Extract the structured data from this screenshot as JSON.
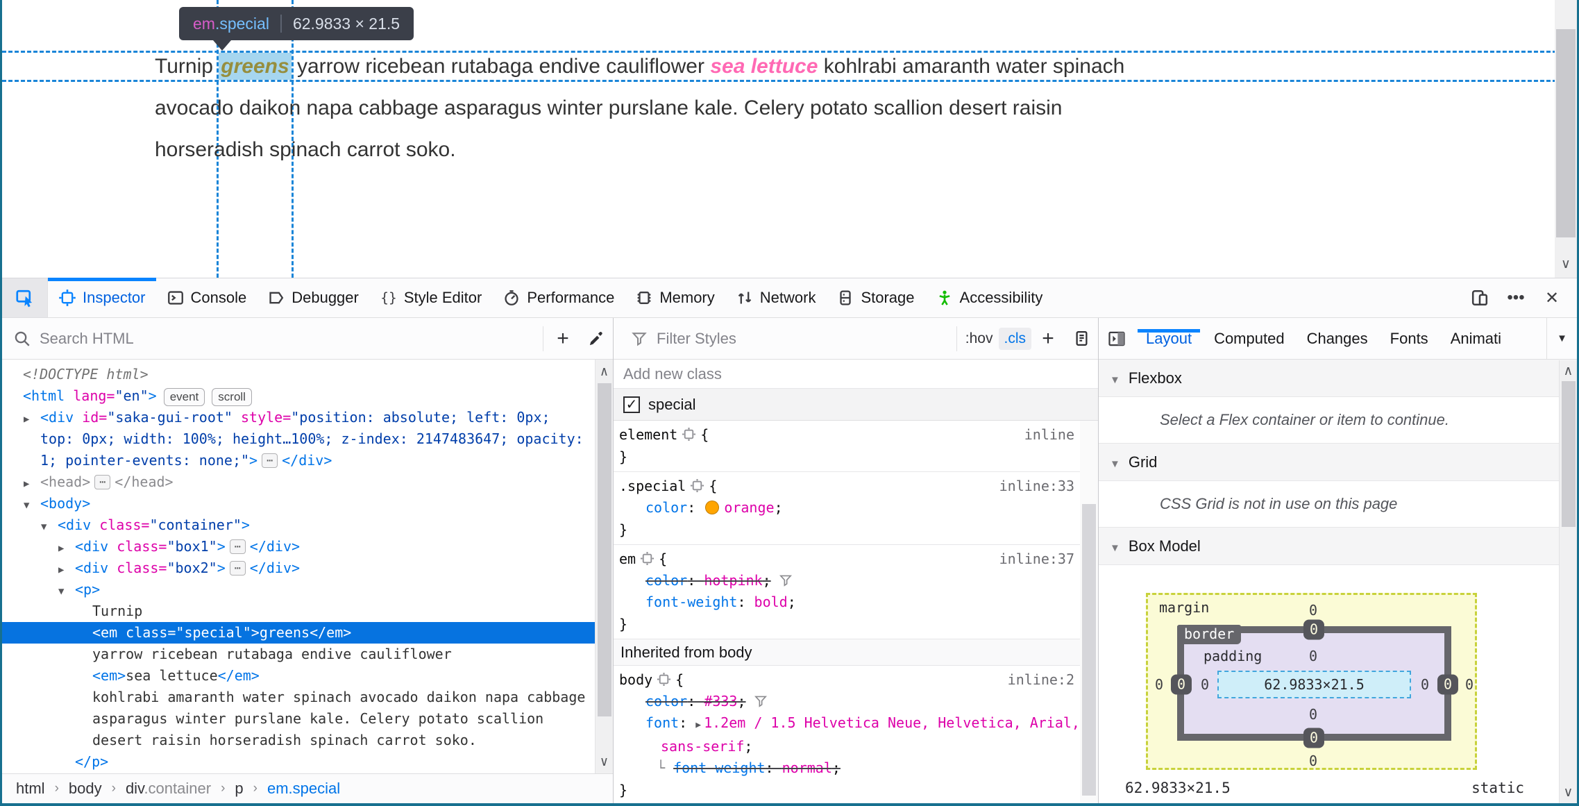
{
  "window": {
    "border_color": "#17708f",
    "accent_blue": "#0a84ff"
  },
  "page": {
    "tooltip": {
      "tag": "em",
      "class": ".special",
      "dims": "62.9833 × 21.5"
    },
    "lines": [
      [
        {
          "c": "plain",
          "t": "Turnip "
        },
        {
          "c": "special",
          "t": "greens"
        },
        {
          "c": "plain",
          "t": " yarrow ricebean rutabaga endive cauliflower "
        },
        {
          "c": "em",
          "t": "sea lettuce"
        },
        {
          "c": "plain",
          "t": " kohlrabi amaranth water spinach"
        }
      ],
      [
        {
          "c": "plain",
          "t": "avocado daikon napa cabbage asparagus winter purslane kale. Celery potato scallion desert raisin"
        }
      ],
      [
        {
          "c": "plain",
          "t": "horseradish spinach carrot soko."
        }
      ]
    ]
  },
  "toolbar": {
    "tabs": [
      {
        "icon": "inspector-icon",
        "label": "Inspector",
        "active": true
      },
      {
        "icon": "console-icon",
        "label": "Console"
      },
      {
        "icon": "debugger-icon",
        "label": "Debugger"
      },
      {
        "icon": "style-editor-icon",
        "label": "Style Editor"
      },
      {
        "icon": "performance-icon",
        "label": "Performance"
      },
      {
        "icon": "memory-icon",
        "label": "Memory"
      },
      {
        "icon": "network-icon",
        "label": "Network"
      },
      {
        "icon": "storage-icon",
        "label": "Storage"
      },
      {
        "icon": "accessibility-icon",
        "label": "Accessibility",
        "icon_color": "#12bc00"
      }
    ],
    "overflow": "•••",
    "close": "✕"
  },
  "markup": {
    "search_placeholder": "Search HTML",
    "add_label": "+",
    "tree": [
      {
        "indent": 0,
        "segs": [
          {
            "c": "doc",
            "t": "<!DOCTYPE html>"
          }
        ]
      },
      {
        "indent": 0,
        "segs": [
          {
            "c": "tag",
            "t": "<html"
          },
          {
            "c": "attr",
            "t": " lang="
          },
          {
            "c": "val",
            "t": "\"en\""
          },
          {
            "c": "tag",
            "t": ">"
          },
          {
            "c": "badge",
            "t": "event"
          },
          {
            "c": "badge",
            "t": "scroll"
          }
        ]
      },
      {
        "indent": 1,
        "arrow": "r",
        "segs": [
          {
            "c": "tag",
            "t": "<div"
          },
          {
            "c": "attr",
            "t": " id="
          },
          {
            "c": "val",
            "t": "\"saka-gui-root\""
          },
          {
            "c": "attr",
            "t": " style="
          },
          {
            "c": "val",
            "t": "\"position: absolute; left: 0px;"
          }
        ]
      },
      {
        "indent": 1,
        "segs": [
          {
            "c": "val",
            "t": "top: 0px; width: 100%; height…100%; z-index: 2147483647; opacity:"
          }
        ]
      },
      {
        "indent": 1,
        "segs": [
          {
            "c": "val",
            "t": "1; pointer-events: none;\""
          },
          {
            "c": "tag",
            "t": ">"
          },
          {
            "c": "chip",
            "t": "⋯"
          },
          {
            "c": "tag",
            "t": "</div>"
          }
        ]
      },
      {
        "indent": 1,
        "arrow": "r",
        "segs": [
          {
            "c": "dim",
            "t": "<head>"
          },
          {
            "c": "chip",
            "t": "⋯"
          },
          {
            "c": "dim",
            "t": "</head>"
          }
        ]
      },
      {
        "indent": 1,
        "arrow": "d",
        "segs": [
          {
            "c": "tag",
            "t": "<body>"
          }
        ]
      },
      {
        "indent": 2,
        "arrow": "d",
        "segs": [
          {
            "c": "tag",
            "t": "<div"
          },
          {
            "c": "attr",
            "t": " class="
          },
          {
            "c": "val",
            "t": "\"container\""
          },
          {
            "c": "tag",
            "t": ">"
          }
        ]
      },
      {
        "indent": 3,
        "arrow": "r",
        "segs": [
          {
            "c": "tag",
            "t": "<div"
          },
          {
            "c": "attr",
            "t": " class="
          },
          {
            "c": "val",
            "t": "\"box1\""
          },
          {
            "c": "tag",
            "t": ">"
          },
          {
            "c": "chip",
            "t": "⋯"
          },
          {
            "c": "tag",
            "t": "</div>"
          }
        ]
      },
      {
        "indent": 3,
        "arrow": "r",
        "segs": [
          {
            "c": "tag",
            "t": "<div"
          },
          {
            "c": "attr",
            "t": " class="
          },
          {
            "c": "val",
            "t": "\"box2\""
          },
          {
            "c": "tag",
            "t": ">"
          },
          {
            "c": "chip",
            "t": "⋯"
          },
          {
            "c": "tag",
            "t": "</div>"
          }
        ]
      },
      {
        "indent": 3,
        "arrow": "d",
        "segs": [
          {
            "c": "tag",
            "t": "<p>"
          }
        ]
      },
      {
        "indent": 4,
        "segs": [
          {
            "c": "txt",
            "t": "Turnip"
          }
        ]
      },
      {
        "indent": 4,
        "selected": true,
        "segs": [
          {
            "c": "w",
            "t": "<em class=\"special\">greens</em>"
          }
        ]
      },
      {
        "indent": 4,
        "segs": [
          {
            "c": "txt",
            "t": "yarrow ricebean rutabaga endive cauliflower"
          }
        ]
      },
      {
        "indent": 4,
        "segs": [
          {
            "c": "tag",
            "t": "<em>"
          },
          {
            "c": "txt",
            "t": "sea lettuce"
          },
          {
            "c": "tag",
            "t": "</em>"
          }
        ]
      },
      {
        "indent": 4,
        "segs": [
          {
            "c": "txt",
            "t": "kohlrabi amaranth water spinach avocado daikon napa cabbage"
          }
        ]
      },
      {
        "indent": 4,
        "segs": [
          {
            "c": "txt",
            "t": "asparagus winter purslane kale. Celery potato scallion"
          }
        ]
      },
      {
        "indent": 4,
        "segs": [
          {
            "c": "txt",
            "t": "desert raisin horseradish spinach carrot soko."
          }
        ]
      },
      {
        "indent": 3,
        "segs": [
          {
            "c": "tag",
            "t": "</p>"
          }
        ]
      }
    ],
    "breadcrumb_sep": "›",
    "breadcrumb": [
      {
        "label": "html"
      },
      {
        "label": "body"
      },
      {
        "label": "div",
        "suffix": ".container"
      },
      {
        "label": "p"
      },
      {
        "label": "em.special",
        "active": true
      }
    ]
  },
  "rules": {
    "filter_placeholder": "Filter Styles",
    "hov_label": ":hov",
    "cls_label": ".cls",
    "add_label": "+",
    "add_class_placeholder": "Add new class",
    "class_toggle": {
      "label": "special",
      "checked": true,
      "check_glyph": "✓"
    },
    "rules": [
      {
        "selector": "element",
        "link": "inline",
        "decls": []
      },
      {
        "selector": ".special",
        "link": "inline:33",
        "decls": [
          {
            "name": "color",
            "value": "orange",
            "swatch": "#ffa500"
          }
        ]
      },
      {
        "selector": "em",
        "link": "inline:37",
        "decls": [
          {
            "name": "color",
            "value": "hotpink",
            "overridden": true,
            "filter": true
          },
          {
            "name": "font-weight",
            "value": "bold"
          }
        ]
      }
    ],
    "inherited_header": "Inherited from body",
    "inherited_rules": [
      {
        "selector": "body",
        "link": "inline:2",
        "decls": [
          {
            "name": "color",
            "value": "#333",
            "overridden": true,
            "filter": true
          },
          {
            "name": "font",
            "value_lines": [
              "1.2em / 1.5 Helvetica Neue, Helvetica, Arial,",
              "sans-serif"
            ],
            "expander": true
          },
          {
            "name": "font-weight",
            "value": "normal",
            "overridden": true,
            "computed": true
          }
        ]
      }
    ]
  },
  "layout": {
    "tabs": [
      {
        "label": "Layout",
        "active": true
      },
      {
        "label": "Computed"
      },
      {
        "label": "Changes"
      },
      {
        "label": "Fonts"
      },
      {
        "label": "Animati",
        "clipped": true
      }
    ],
    "flexbox": {
      "title": "Flexbox",
      "note": "Select a Flex container or item to continue."
    },
    "grid": {
      "title": "Grid",
      "note": "CSS Grid is not in use on this page"
    },
    "box_model": {
      "title": "Box Model",
      "margin_label": "margin",
      "border_label": "border",
      "padding_label": "padding",
      "content": "62.9833×21.5",
      "margin": {
        "top": "0",
        "right": "0",
        "bottom": "0",
        "left": "0"
      },
      "border": {
        "top": "0",
        "right": "0",
        "bottom": "0",
        "left": "0"
      },
      "padding": {
        "top": "0",
        "right": "0",
        "bottom": "0",
        "left": "0"
      },
      "footer_dims": "62.9833×21.5",
      "footer_position": "static"
    }
  }
}
